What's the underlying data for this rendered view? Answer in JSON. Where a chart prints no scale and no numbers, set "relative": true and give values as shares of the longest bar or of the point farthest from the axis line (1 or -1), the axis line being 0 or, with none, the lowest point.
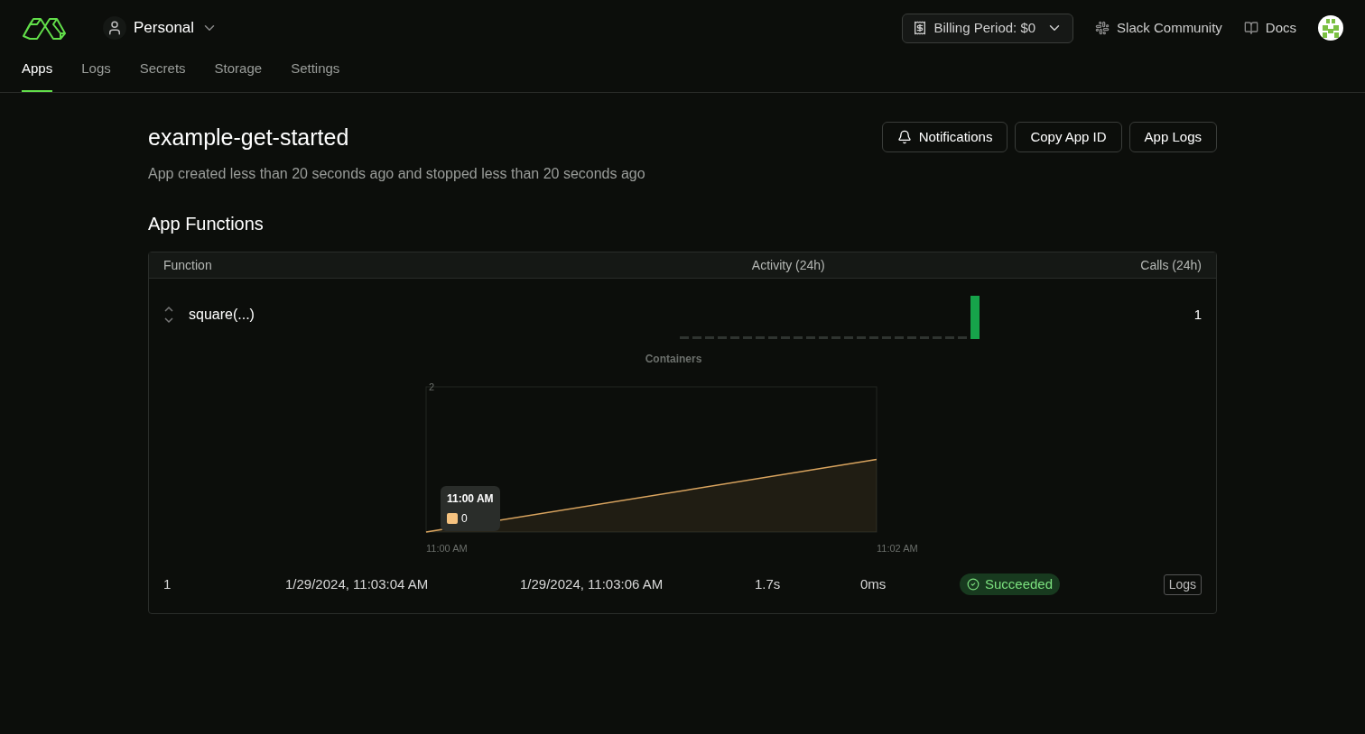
{
  "header": {
    "workspace": "Personal",
    "billing": "Billing Period: $0",
    "links": [
      {
        "kind": "slack",
        "label": "Slack Community"
      },
      {
        "kind": "docs",
        "label": "Docs"
      }
    ]
  },
  "tabs": [
    {
      "label": "Apps",
      "selected": true
    },
    {
      "label": "Logs",
      "selected": false
    },
    {
      "label": "Secrets",
      "selected": false
    },
    {
      "label": "Storage",
      "selected": false
    },
    {
      "label": "Settings",
      "selected": false
    }
  ],
  "app": {
    "title": "example-get-started",
    "subtitle": "App created less than 20 seconds ago and stopped less than 20 seconds ago",
    "buttons": [
      {
        "kind": "bell",
        "label": "Notifications"
      },
      {
        "kind": "plain",
        "label": "Copy App ID"
      },
      {
        "kind": "plain",
        "label": "App Logs"
      }
    ]
  },
  "section_title": "App Functions",
  "table": {
    "columns": [
      "Function",
      "Activity (24h)",
      "Calls (24h)"
    ],
    "rows": [
      {
        "name": "square(...)",
        "calls": "1",
        "containers": {
          "chart_data": {
            "type": "area",
            "title": "Containers",
            "categories": [
              "11:00 AM",
              "11:02 AM"
            ],
            "relative": true,
            "annotations": [
              {
                "text": "2"
              }
            ],
            "series": [
              {
                "color": "#d9a45f",
                "values": [
                  0,
                  1
                ]
              }
            ]
          },
          "tooltip": {
            "time": "11:00 AM",
            "value": "0",
            "color": "#f5c27f"
          }
        },
        "runs": [
          {
            "cells": [
              "1",
              "1/29/2024, 11:03:04 AM",
              "1/29/2024, 11:03:06 AM",
              "1.7s",
              "0ms"
            ],
            "status": "Succeeded",
            "logs": "Logs"
          }
        ]
      }
    ]
  }
}
